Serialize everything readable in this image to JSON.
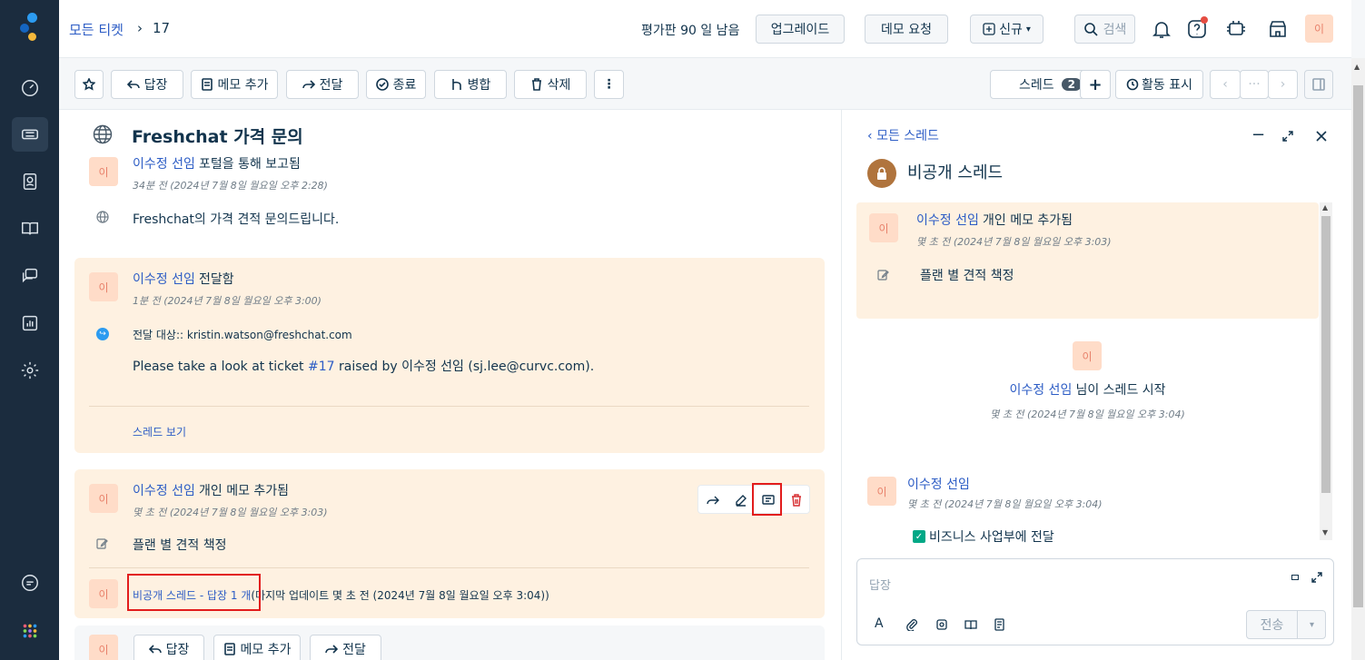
{
  "breadcrumb": {
    "all_tickets": "모든 티켓",
    "separator": "›",
    "ticket_number": "17"
  },
  "header": {
    "trial_text": "평가판 90 일 남음",
    "upgrade_label": "업그레이드",
    "demo_label": "데모 요청",
    "new_label": "신규",
    "search_label": "검색",
    "avatar": "이"
  },
  "toolbar": {
    "reply": "답장",
    "add_note": "메모 추가",
    "forward": "전달",
    "close": "종료",
    "merge": "병합",
    "delete": "삭제",
    "more": "⋮",
    "threads_label": "스레드",
    "threads_count": "2",
    "plus": "+",
    "activity": "활동 표시",
    "prev": "‹",
    "dots": "···",
    "next": "›"
  },
  "ticket": {
    "title": "Freshchat 가격 문의",
    "avatar": "이",
    "author": "이수정 선임",
    "event": "포털을 통해 보고됨",
    "time": "34분 전 (2024년 7월 8일 월요일 오후 2:28)",
    "body": "Freshchat의 가격 견적 문의드립니다."
  },
  "forward_card": {
    "avatar": "이",
    "author": "이수정 선임",
    "event": "전달함",
    "time": "1분 전 (2024년 7월 8일 월요일 오후 3:00)",
    "to_label": "전달 대상:: kristin.watson@freshchat.com",
    "body_pre": "Please take a look at ticket ",
    "body_link": "#17",
    "body_post": " raised by 이수정 선임 (sj.lee@curvc.com).",
    "view_thread": "스레드 보기"
  },
  "note_card": {
    "avatar": "이",
    "author": "이수정 선임",
    "event": "개인 메모 추가됨",
    "time": "몇 초 전 (2024년 7월 8일 월요일 오후 3:03)",
    "body": "플랜 별 견적 책정",
    "thread_avatar": "이",
    "thread_link": "비공개 스레드 - 답장 1 개",
    "thread_meta": "(마지막 업데이트 몇 초 전 (2024년 7월 8일 월요일 오후 3:04))"
  },
  "bottom_actions": {
    "avatar": "이",
    "reply": "답장",
    "add_note": "메모 추가",
    "forward": "전달"
  },
  "side": {
    "back_label": "모든 스레드",
    "title": "비공개 스레드",
    "note": {
      "avatar": "이",
      "author": "이수정 선임",
      "event": "개인 메모 추가됨",
      "time": "몇 초 전 (2024년 7월 8일 월요일 오후 3:03)",
      "body": "플랜 별 견적 책정"
    },
    "started": {
      "avatar": "이",
      "author": "이수정 선임",
      "event": "님이 스레드 시작",
      "time": "몇 초 전 (2024년 7월 8일 월요일 오후 3:04)"
    },
    "reply": {
      "avatar": "이",
      "author": "이수정 선임",
      "time": "몇 초 전 (2024년 7월 8일 월요일 오후 3:04)",
      "body": "비즈니스 사업부에 전달"
    },
    "editor_placeholder": "답장",
    "send_label": "전송"
  },
  "colors": {
    "nav_bg": "#1b2c3e",
    "link": "#2c5cc5",
    "card_bg": "#fef1e1",
    "highlight": "#e21c1c",
    "avatar_bg": "#ffdcc8"
  }
}
